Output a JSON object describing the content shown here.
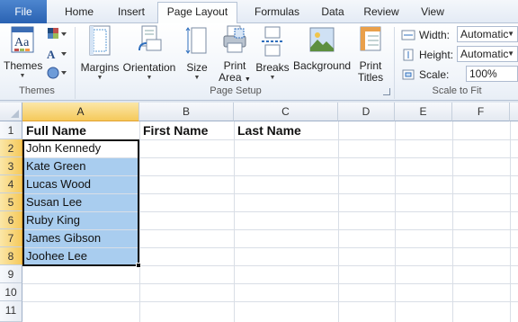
{
  "tabs": [
    "File",
    "Home",
    "Insert",
    "Page Layout",
    "Formulas",
    "Data",
    "Review",
    "View"
  ],
  "ribbon": {
    "themes": {
      "button": "Themes",
      "group_label": "Themes"
    },
    "page_setup": {
      "margins": "Margins",
      "orientation": "Orientation",
      "size": "Size",
      "print_area_line1": "Print",
      "print_area_line2": "Area",
      "breaks": "Breaks",
      "background": "Background",
      "print_titles_line1": "Print",
      "print_titles_line2": "Titles",
      "group_label": "Page Setup"
    },
    "scale_to_fit": {
      "width_label": "Width:",
      "width_value": "Automatic",
      "height_label": "Height:",
      "height_value": "Automatic",
      "scale_label": "Scale:",
      "scale_value": "100%",
      "group_label": "Scale to Fit"
    }
  },
  "grid": {
    "columns": [
      "A",
      "B",
      "C",
      "D",
      "E",
      "F"
    ],
    "rows": [
      "1",
      "2",
      "3",
      "4",
      "5",
      "6",
      "7",
      "8",
      "9",
      "10",
      "11"
    ],
    "headers": {
      "A1": "Full Name",
      "B1": "First Name",
      "C1": "Last Name"
    },
    "names": [
      "John Kennedy",
      "Kate Green",
      "Lucas Wood",
      "Susan Lee",
      "Ruby King",
      "James Gibson",
      "Joohee Lee"
    ],
    "selected_range": "A2:A8",
    "highlight_color": "#a9cdef"
  }
}
